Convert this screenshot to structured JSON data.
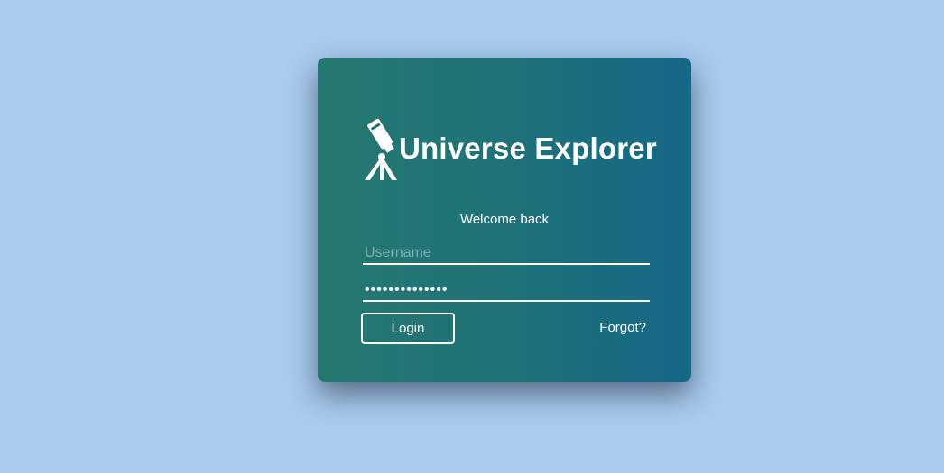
{
  "brand": {
    "title": "Universe Explorer",
    "icon": "telescope-icon"
  },
  "login_form": {
    "welcome": "Welcome back",
    "username_placeholder": "Username",
    "username_value": "",
    "password_value": "••••••••••••••",
    "login_label": "Login",
    "forgot_label": "Forgot?"
  },
  "colors": {
    "background": "#a9cbef",
    "card_gradient_start": "#25786f",
    "card_gradient_end": "#156886",
    "text": "#ffffff"
  }
}
